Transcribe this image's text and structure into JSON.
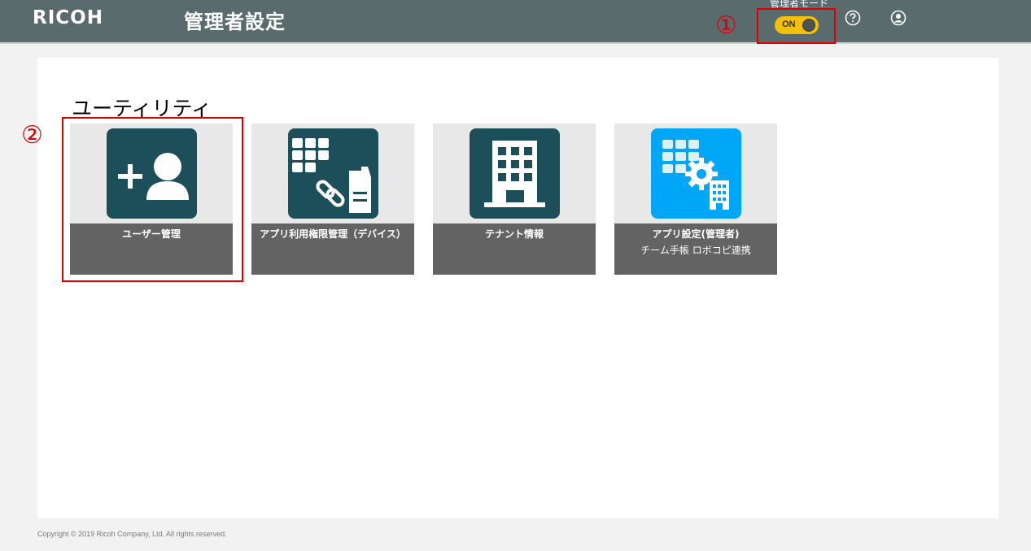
{
  "header": {
    "logo": "RICOH",
    "title": "管理者設定",
    "admin_mode_label": "管理者モード",
    "admin_mode_toggle": "ON",
    "help_icon": "question-circle-icon",
    "account_icon": "user-circle-icon"
  },
  "annotations": {
    "marker_1": "①",
    "marker_2": "②",
    "highlight_color": "#e00000"
  },
  "main": {
    "section_title": "ユーティリティ",
    "tiles": [
      {
        "label": "ユーザー管理",
        "sublabel": "",
        "icon": "add-user-icon",
        "color": "#1c4f5a"
      },
      {
        "label": "アプリ利用権限管理（デバイス）",
        "sublabel": "",
        "icon": "app-device-link-icon",
        "color": "#1c4f5a"
      },
      {
        "label": "テナント情報",
        "sublabel": "",
        "icon": "building-icon",
        "color": "#1c4f5a"
      },
      {
        "label": "アプリ設定(管理者)",
        "sublabel": "チーム手帳 ロボコピ連携",
        "icon": "app-settings-icon",
        "color": "#00a6f8"
      }
    ]
  },
  "footer": {
    "copyright": "Copyright © 2019 Ricoh Company, Ltd. All rights reserved."
  },
  "colors": {
    "header_bg": "#5a6b6e",
    "toggle_on": "#f5c000",
    "tile_label_bg": "#636363"
  }
}
